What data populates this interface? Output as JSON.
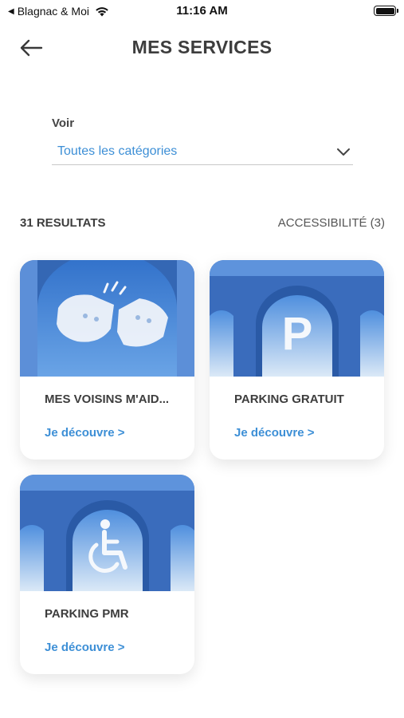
{
  "status_bar": {
    "back_app": "Blagnac & Moi",
    "time": "11:16 AM"
  },
  "header": {
    "title": "MES SERVICES",
    "back_icon": "arrow-left-icon"
  },
  "filter": {
    "label": "Voir",
    "value": "Toutes les catégories",
    "icon": "chevron-down-icon"
  },
  "results": {
    "count_label": "31 RESULTATS",
    "accessibility_label": "ACCESSIBILITÉ (3)"
  },
  "cards": [
    {
      "title": "MES VOISINS M'AID...",
      "link": "Je découvre >",
      "image": "clouds-hands-image"
    },
    {
      "title": "PARKING GRATUIT",
      "link": "Je découvre >",
      "image": "parking-p-image"
    },
    {
      "title": "PARKING PMR",
      "link": "Je découvre >",
      "image": "wheelchair-image"
    }
  ],
  "colors": {
    "accent": "#3d8fd6",
    "sky": "#4a84d4",
    "arch": "#2f66b8"
  }
}
